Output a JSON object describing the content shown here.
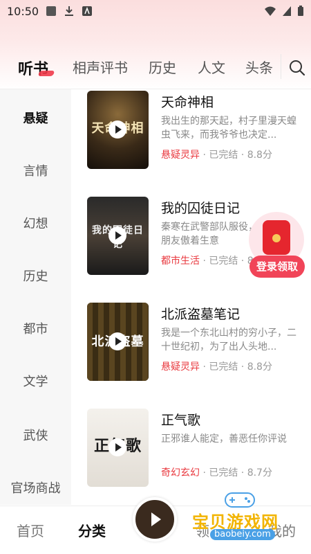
{
  "status_bar": {
    "time": "10:50"
  },
  "top_tabs": [
    "听书",
    "相声评书",
    "历史",
    "人文",
    "头条"
  ],
  "categories": [
    "悬疑",
    "言情",
    "幻想",
    "历史",
    "都市",
    "文学",
    "武侠",
    "官场商战"
  ],
  "books": [
    {
      "title": "天命神相",
      "desc": "我出生的那天起，村子里漫天蝗虫飞来，而我爷爷也决定...",
      "genre": "悬疑灵异",
      "meta": " · 已完结 · 8.8分",
      "cover_text": "天命神相"
    },
    {
      "title": "我的囚徒日记",
      "desc": "秦寒在武警部队服役，回家后和朋友傲着生意",
      "genre": "都市生活",
      "meta": " · 已完结 · 8",
      "cover_text": "我的囚徒日记"
    },
    {
      "title": "北派盗墓笔记",
      "desc": "我是一个东北山村的穷小子，二十世纪初，为了出人头地...",
      "genre": "悬疑灵异",
      "meta": " · 已完结 · 8.8分",
      "cover_text": "北派盗墓"
    },
    {
      "title": "正气歌",
      "desc": "正邪谁人能定，善恶任你评说",
      "genre": "奇幻玄幻",
      "meta": " · 已完结 · 8.7分",
      "cover_text": "正气歌"
    }
  ],
  "floating": {
    "login_label": "登录领取"
  },
  "bottom_nav": {
    "home": "首页",
    "category": "分类",
    "center_partial": "领",
    "mine_partial": "我的"
  },
  "watermark": {
    "text": "宝贝游戏网",
    "url": "baobeiy.com"
  },
  "colors": {
    "accent": "#e9393f",
    "login_button": "#f14458"
  }
}
